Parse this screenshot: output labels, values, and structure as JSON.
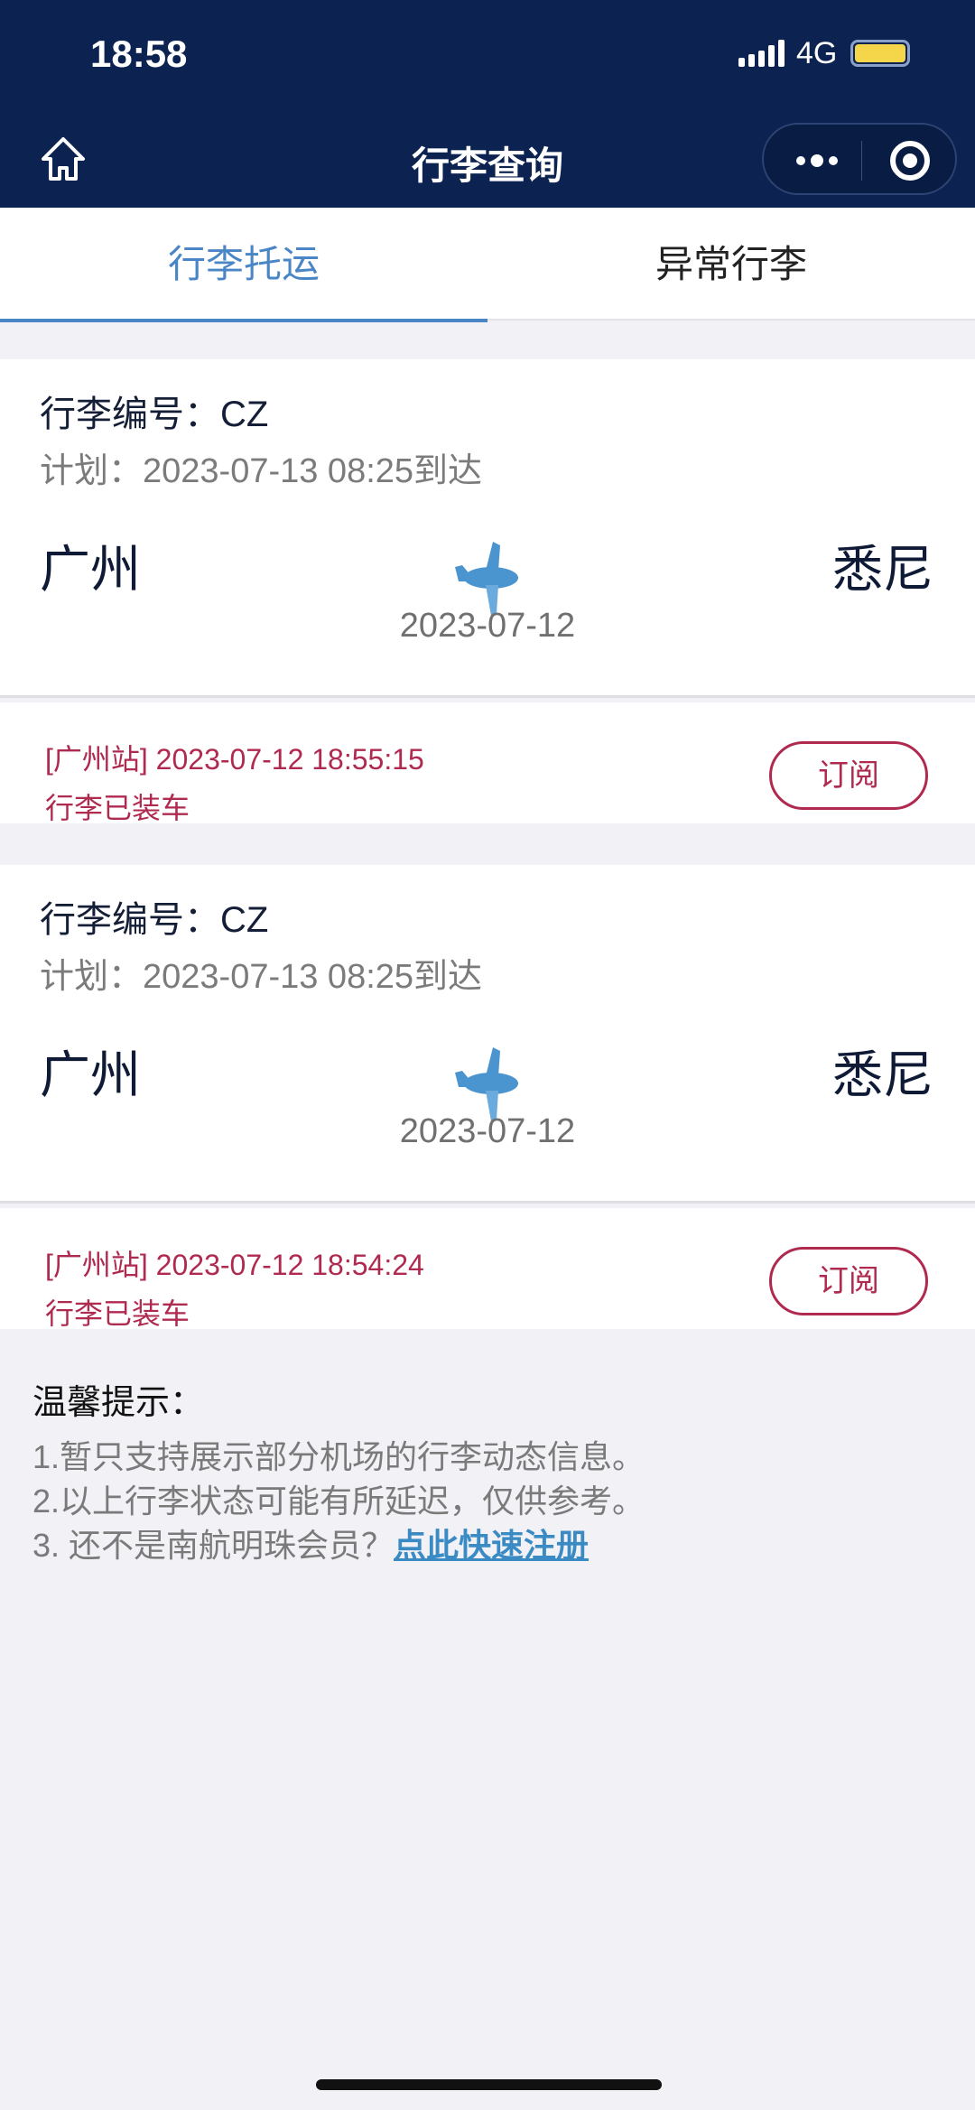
{
  "status_bar": {
    "time": "18:58",
    "network": "4G",
    "battery_color": "#f5d54a"
  },
  "nav": {
    "title": "行李查询",
    "home_icon": "home-icon",
    "more_icon": "more-dots-icon",
    "close_icon": "target-icon"
  },
  "tabs": [
    {
      "label": "行李托运",
      "active": true
    },
    {
      "label": "异常行李",
      "active": false
    }
  ],
  "cards": [
    {
      "bag_no": "行李编号：CZ",
      "plan": "计划：2023-07-13 08:25到达",
      "from": "广州",
      "to": "悉尼",
      "date": "2023-07-12",
      "station_time": "[广州站] 2023-07-12 18:55:15",
      "status": "行李已装车",
      "subscribe": "订阅"
    },
    {
      "bag_no": "行李编号：CZ",
      "plan": "计划：2023-07-13 08:25到达",
      "from": "广州",
      "to": "悉尼",
      "date": "2023-07-12",
      "station_time": "[广州站] 2023-07-12 18:54:24",
      "status": "行李已装车",
      "subscribe": "订阅"
    }
  ],
  "tips": {
    "title": "温馨提示：",
    "line1": "1.暂只支持展示部分机场的行李动态信息。",
    "line2": "2.以上行李状态可能有所延迟，仅供参考。",
    "line3": "3. 还不是南航明珠会员？",
    "link": "点此快速注册"
  },
  "colors": {
    "nav_bg": "#0c2352",
    "accent": "#4a86c6",
    "status_red": "#b0294f"
  }
}
